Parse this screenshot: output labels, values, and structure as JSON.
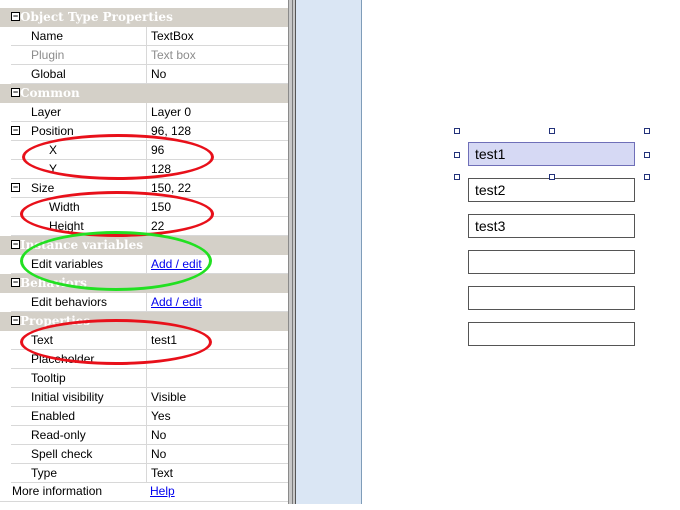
{
  "properties": {
    "categories": {
      "object_type": "Object Type Properties",
      "common": "Common",
      "instance_variables": "Instance variables",
      "behaviors": "Behaviors",
      "properties": "Properties"
    },
    "name": {
      "label": "Name",
      "value": "TextBox"
    },
    "plugin": {
      "label": "Plugin",
      "value": "Text box"
    },
    "global": {
      "label": "Global",
      "value": "No"
    },
    "layer": {
      "label": "Layer",
      "value": "Layer 0"
    },
    "position": {
      "label": "Position",
      "value": "96, 128"
    },
    "x": {
      "label": "X",
      "value": "96"
    },
    "y": {
      "label": "Y",
      "value": "128"
    },
    "size": {
      "label": "Size",
      "value": "150, 22"
    },
    "width": {
      "label": "Width",
      "value": "150"
    },
    "height": {
      "label": "Height",
      "value": "22"
    },
    "edit_variables": {
      "label": "Edit variables",
      "value": "Add / edit"
    },
    "edit_behaviors": {
      "label": "Edit behaviors",
      "value": "Add / edit"
    },
    "text": {
      "label": "Text",
      "value": "test1"
    },
    "placeholder": {
      "label": "Placeholder",
      "value": ""
    },
    "tooltip": {
      "label": "Tooltip",
      "value": ""
    },
    "initial_visibility": {
      "label": "Initial visibility",
      "value": "Visible"
    },
    "enabled": {
      "label": "Enabled",
      "value": "Yes"
    },
    "read_only": {
      "label": "Read-only",
      "value": "No"
    },
    "spell_check": {
      "label": "Spell check",
      "value": "No"
    },
    "type": {
      "label": "Type",
      "value": "Text"
    },
    "more_information": {
      "label": "More information",
      "value": "Help"
    }
  },
  "canvas": {
    "textboxes": [
      "test1",
      "test2",
      "test3",
      "",
      "",
      ""
    ]
  },
  "colors": {
    "red_annotation": "#e8101a",
    "green_annotation": "#22e022",
    "selection": "#d6d9f4"
  },
  "expanders": {
    "minus": "−"
  }
}
